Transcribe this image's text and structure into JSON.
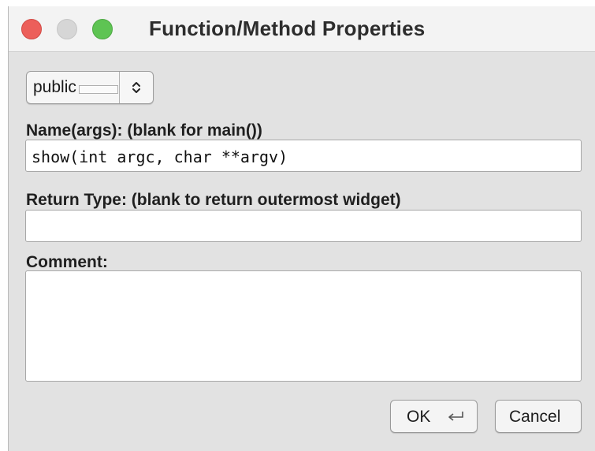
{
  "window": {
    "title": "Function/Method Properties"
  },
  "access_select": {
    "selected": "public"
  },
  "name_field": {
    "label": "Name(args): (blank for main())",
    "value": "show(int argc, char **argv)"
  },
  "return_field": {
    "label": "Return Type: (blank to return outermost widget)",
    "value": ""
  },
  "comment_field": {
    "label": "Comment:",
    "value": ""
  },
  "buttons": {
    "ok_label": "OK",
    "cancel_label": "Cancel"
  },
  "icons": {
    "close": "close-button",
    "minimize": "minimize-button",
    "zoom": "zoom-button",
    "select_arrows": "up-down-chevron-icon",
    "return_key": "return-key-icon"
  },
  "colors": {
    "close": "#ec5f5a",
    "minimize": "#d6d6d6",
    "zoom": "#5ec453",
    "window_bg": "#e2e2e2"
  }
}
